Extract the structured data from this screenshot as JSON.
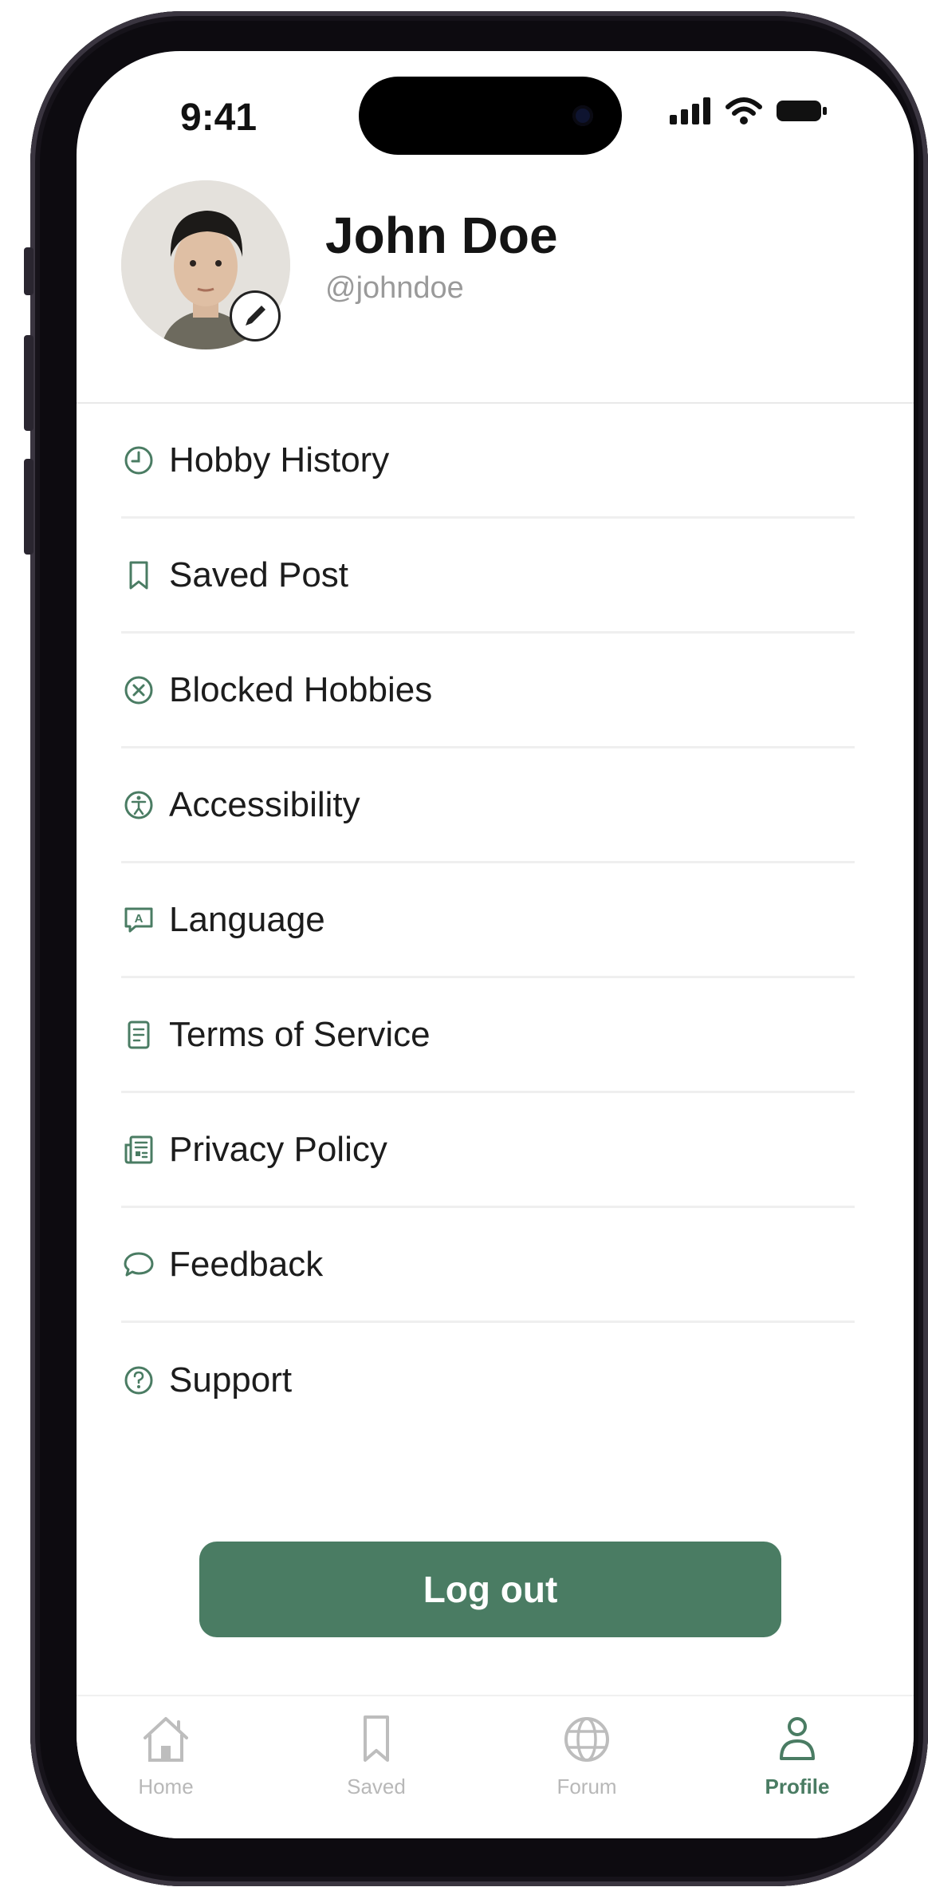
{
  "status_bar": {
    "time": "9:41"
  },
  "profile": {
    "name": "John Doe",
    "handle": "@johndoe"
  },
  "menu": {
    "items": [
      {
        "label": "Hobby History",
        "icon": "clock-icon"
      },
      {
        "label": "Saved Post",
        "icon": "bookmark-icon"
      },
      {
        "label": "Blocked Hobbies",
        "icon": "blocked-icon"
      },
      {
        "label": "Accessibility",
        "icon": "accessibility-icon"
      },
      {
        "label": "Language",
        "icon": "language-icon"
      },
      {
        "label": "Terms of Service",
        "icon": "document-icon"
      },
      {
        "label": "Privacy Policy",
        "icon": "newspaper-icon"
      },
      {
        "label": "Feedback",
        "icon": "chat-bubble-icon"
      },
      {
        "label": "Support",
        "icon": "help-icon"
      }
    ]
  },
  "logout": {
    "label": "Log out"
  },
  "tab_bar": {
    "tabs": [
      {
        "label": "Home",
        "icon": "home-icon"
      },
      {
        "label": "Saved",
        "icon": "bookmark-icon"
      },
      {
        "label": "Forum",
        "icon": "globe-icon"
      },
      {
        "label": "Profile",
        "icon": "person-icon"
      }
    ],
    "active": "Profile"
  },
  "colors": {
    "accent": "#4a7c63",
    "inactive_tab": "#b8b8b8",
    "divider": "#efefef"
  }
}
